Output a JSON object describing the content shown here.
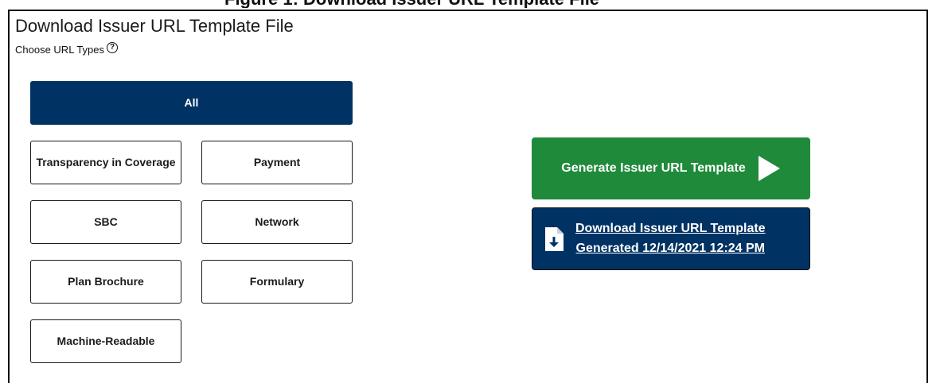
{
  "top_caption": "Figure 1: Download Issuer URL Template File",
  "panel": {
    "title": "Download Issuer URL Template File",
    "choose_label": "Choose URL Types",
    "help_symbol": "?"
  },
  "url_types": {
    "all": "All",
    "transparency": "Transparency in Coverage",
    "payment": "Payment",
    "sbc": "SBC",
    "network": "Network",
    "plan_brochure": "Plan Brochure",
    "formulary": "Formulary",
    "machine_readable": "Machine-Readable"
  },
  "actions": {
    "generate_label": "Generate Issuer URL Template",
    "download_line1": "Download Issuer URL Template",
    "download_line2": "Generated 12/14/2021 12:24 PM"
  },
  "colors": {
    "navy": "#003264",
    "green": "#1f8a3a"
  },
  "icons": {
    "help": "help-circle-icon",
    "generate": "play-triangle-icon",
    "download": "file-download-icon"
  }
}
